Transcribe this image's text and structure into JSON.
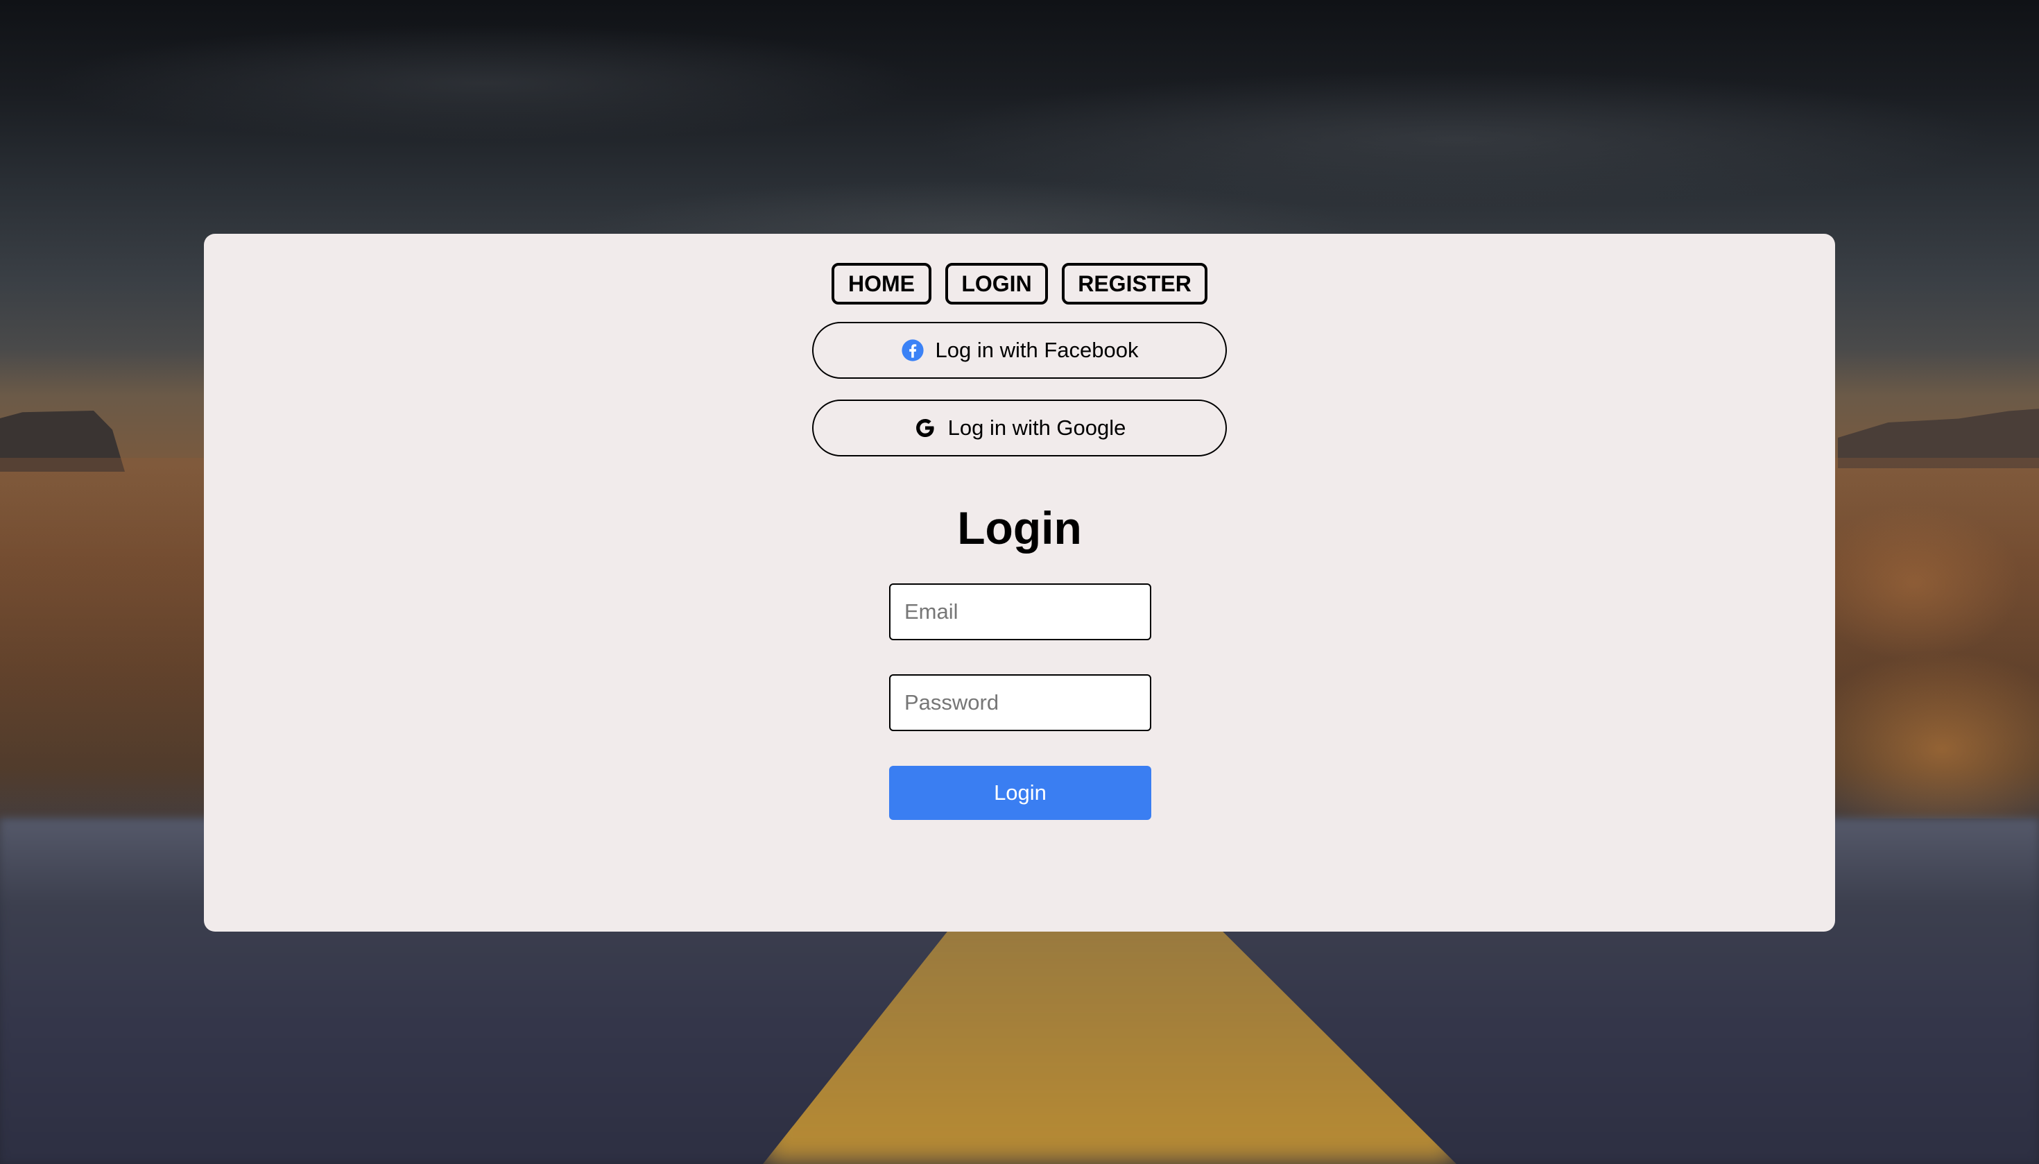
{
  "nav": {
    "home_label": "HOME",
    "login_label": "LOGIN",
    "register_label": "REGISTER"
  },
  "social": {
    "facebook_label": "Log in with Facebook",
    "facebook_icon": "facebook-icon",
    "google_label": "Log in with Google",
    "google_icon": "google-icon"
  },
  "form": {
    "title": "Login",
    "email_placeholder": "Email",
    "email_value": "",
    "password_placeholder": "Password",
    "password_value": "",
    "submit_label": "Login"
  },
  "colors": {
    "card_background": "#f1ebeb",
    "primary_button": "#3a7ef2",
    "facebook_blue": "#3b82f6"
  }
}
